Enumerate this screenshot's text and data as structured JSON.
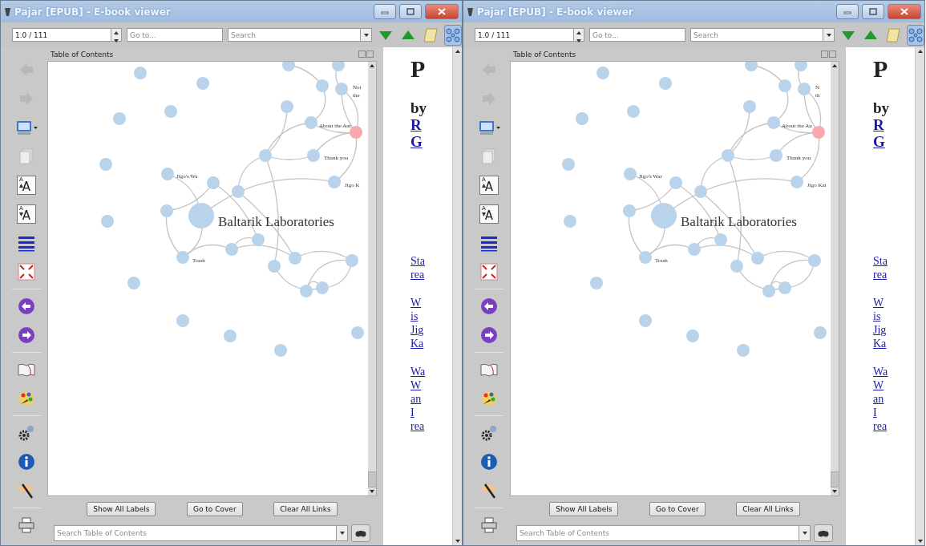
{
  "windows": [
    {
      "title": "Pajar [EPUB] - E-book viewer",
      "toolbar": {
        "position": "1.0 / 111",
        "goto_placeholder": "Go to...",
        "search_placeholder": "Search",
        "graph_toggle_pressed": true
      },
      "sidebar": {
        "font_buttons": [
          {
            "kind": "larger",
            "small": "A",
            "big": "A"
          },
          {
            "kind": "smaller",
            "small": "A",
            "big": "A"
          }
        ]
      },
      "toc": {
        "title": "Table of Contents",
        "graph_labels": [
          "Not",
          "the",
          "About the Aut",
          "Thank you",
          "Jigo K",
          "Jigo's Wa",
          "Baltarik Laboratories",
          "Trash"
        ],
        "buttons": [
          "Show All Labels",
          "Go to Cover",
          "Clear All Links"
        ],
        "search_placeholder": "Search Table of Contents"
      },
      "page": {
        "heading": "P",
        "byline": "by",
        "author_lines": [
          "R",
          "G"
        ],
        "link_groups": [
          [
            "Sta",
            "rea"
          ],
          [
            "W",
            "is",
            "Jig",
            "Ka"
          ],
          [
            "Wa",
            "W",
            "an",
            "I",
            "rea"
          ]
        ]
      }
    },
    {
      "title": "Pajar [EPUB] - E-book viewer",
      "toolbar": {
        "position": "1.0 / 111",
        "goto_placeholder": "Go to...",
        "search_placeholder": "Search",
        "graph_toggle_pressed": true
      },
      "sidebar": {
        "font_buttons": [
          {
            "kind": "larger",
            "small": "A",
            "big": "A"
          },
          {
            "kind": "smaller",
            "small": "A",
            "big": "A"
          }
        ]
      },
      "toc": {
        "title": "Table of Contents",
        "graph_labels": [
          "N",
          "th",
          "About the Au",
          "Thank you",
          "Jigo Kat",
          "Jigo's War",
          "Baltarik Laboratories",
          "Trash"
        ],
        "buttons": [
          "Show All Labels",
          "Go to Cover",
          "Clear All Links"
        ],
        "search_placeholder": "Search Table of Contents"
      },
      "page": {
        "heading": "P",
        "byline": "by",
        "author_lines": [
          "R",
          "G"
        ],
        "link_groups": [
          [
            "Sta",
            "rea"
          ],
          [
            "W",
            "is",
            "Jig",
            "Ka"
          ],
          [
            "Wa",
            "W",
            "an",
            "I",
            "rea"
          ]
        ]
      }
    }
  ]
}
